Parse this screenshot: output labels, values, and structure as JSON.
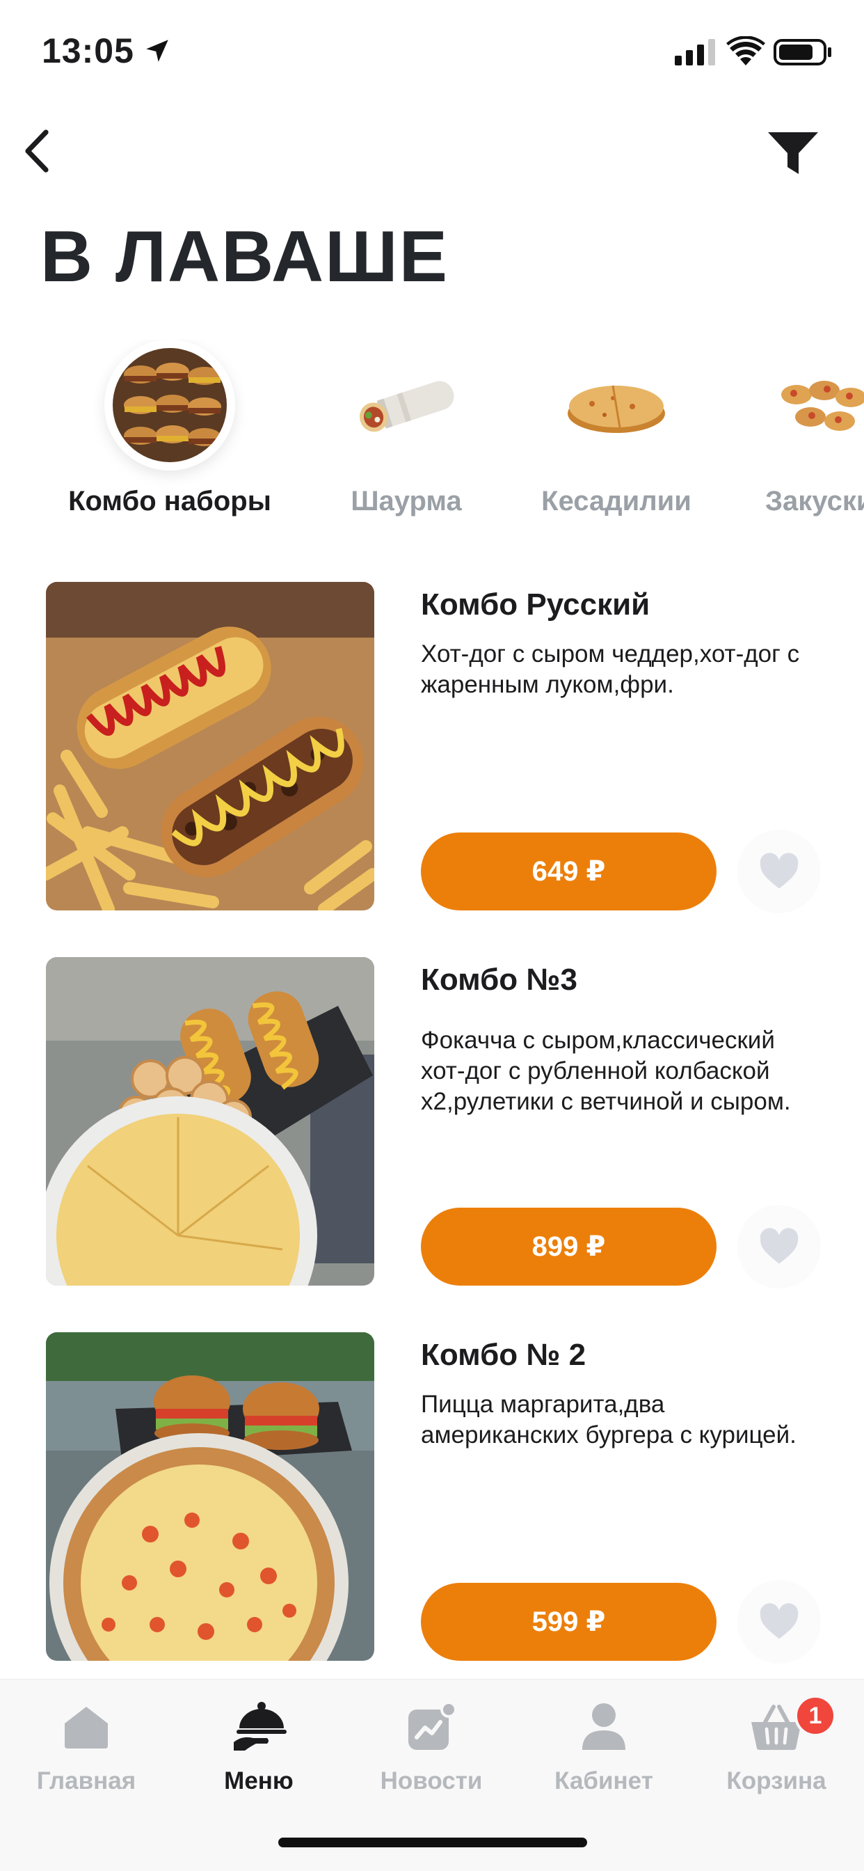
{
  "status_bar": {
    "time": "13:05"
  },
  "header": {
    "title": "В ЛАВАШЕ"
  },
  "categories": [
    {
      "label": "Комбо наборы",
      "active": true
    },
    {
      "label": "Шаурма",
      "active": false
    },
    {
      "label": "Кесадилии",
      "active": false
    },
    {
      "label": "Закуски",
      "active": false
    }
  ],
  "products": [
    {
      "title": "Комбо Русский",
      "description": "Хот-дог с сыром чеддер,хот-дог с жаренным луком,фри.",
      "price": "649 ₽"
    },
    {
      "title": "Комбо №3",
      "description": "Фокачча с сыром,классический хот-дог с рубленной колбаской х2,рулетики с ветчиной и сыром.",
      "price": "899 ₽"
    },
    {
      "title": "Комбо № 2",
      "description": "Пицца маргарита,два американских бургера с курицей.",
      "price": "599 ₽"
    }
  ],
  "tab_bar": {
    "tabs": [
      {
        "label": "Главная",
        "icon": "home-icon",
        "active": false
      },
      {
        "label": "Меню",
        "icon": "cloche-icon",
        "active": true
      },
      {
        "label": "Новости",
        "icon": "news-icon",
        "active": false
      },
      {
        "label": "Кабинет",
        "icon": "user-icon",
        "active": false
      },
      {
        "label": "Корзина",
        "icon": "basket-icon",
        "active": false,
        "badge": "1"
      }
    ]
  },
  "colors": {
    "accent": "#ec7f0a",
    "badge": "#f0463c",
    "inactive": "#b5b8bc",
    "heart": "#d9dde3"
  }
}
